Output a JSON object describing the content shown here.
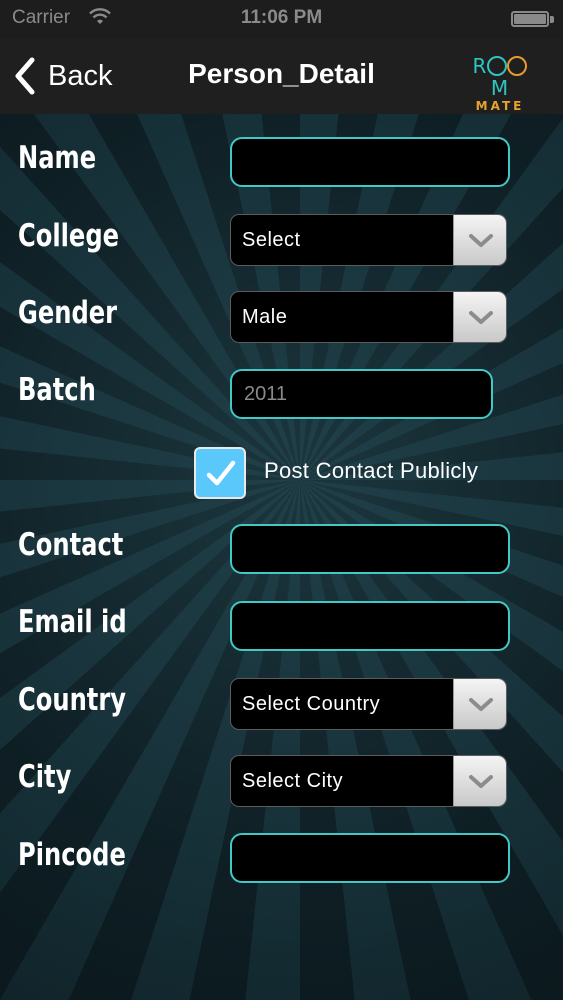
{
  "status_bar": {
    "carrier": "Carrier",
    "time": "11:06 PM"
  },
  "nav": {
    "back_label": "Back",
    "title": "Person_Detail",
    "logo": {
      "line1_a": "R",
      "line1_b": "M",
      "line2": "MATE"
    }
  },
  "form": {
    "name_label": "Name",
    "college_label": "College",
    "college_value": "Select",
    "gender_label": "Gender",
    "gender_value": "Male",
    "batch_label": "Batch",
    "batch_placeholder": "2011",
    "post_contact_label": "Post Contact Publicly",
    "post_contact_checked": true,
    "contact_label": "Contact",
    "email_label": "Email id",
    "country_label": "Country",
    "country_value": "Select Country",
    "city_label": "City",
    "city_value": "Select City",
    "pincode_label": "Pincode"
  },
  "colors": {
    "field_border": "#44c8c6",
    "checkbox_fill": "#5ac8fa",
    "logo_teal": "#2fc5c0",
    "logo_orange": "#e8a32c"
  }
}
